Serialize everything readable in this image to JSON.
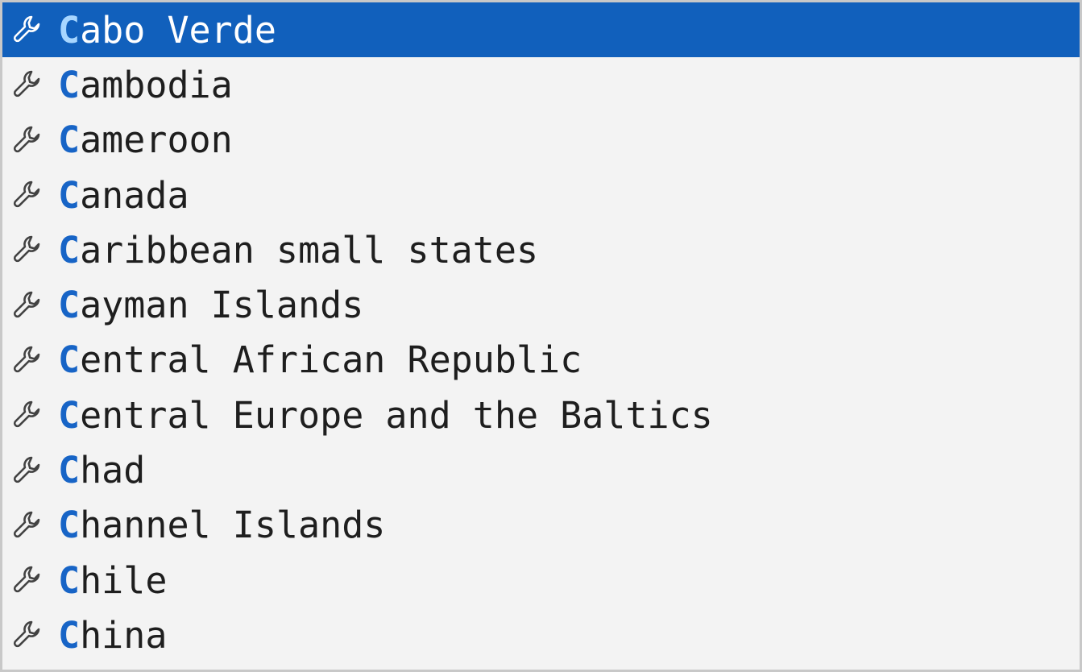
{
  "suggestions": {
    "selected_index": 0,
    "colors": {
      "selected_bg": "#1160bc",
      "match_highlight": "#1764c6",
      "selected_match_highlight": "#a7d6ff",
      "text": "#1e1e1e",
      "background": "#f3f3f3"
    },
    "icon": "wrench-icon",
    "items": [
      {
        "match": "C",
        "rest": "abo Verde"
      },
      {
        "match": "C",
        "rest": "ambodia"
      },
      {
        "match": "C",
        "rest": "ameroon"
      },
      {
        "match": "C",
        "rest": "anada"
      },
      {
        "match": "C",
        "rest": "aribbean small states"
      },
      {
        "match": "C",
        "rest": "ayman Islands"
      },
      {
        "match": "C",
        "rest": "entral African Republic"
      },
      {
        "match": "C",
        "rest": "entral Europe and the Baltics"
      },
      {
        "match": "C",
        "rest": "had"
      },
      {
        "match": "C",
        "rest": "hannel Islands"
      },
      {
        "match": "C",
        "rest": "hile"
      },
      {
        "match": "C",
        "rest": "hina"
      }
    ]
  }
}
